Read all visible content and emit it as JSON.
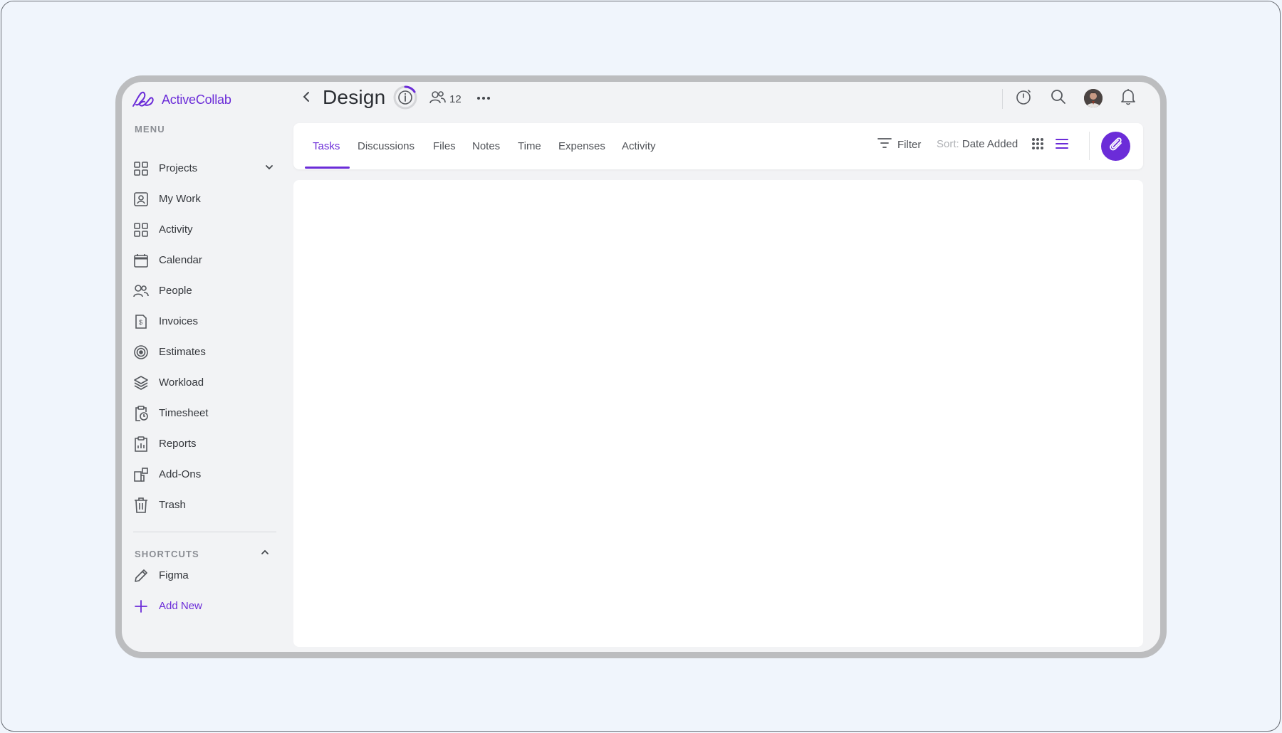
{
  "app": {
    "name": "ActiveCollab",
    "brand_color": "#6b2cd8"
  },
  "sidebar": {
    "menu_heading": "MENU",
    "items": [
      {
        "label": "Projects",
        "icon": "grid-icon"
      },
      {
        "label": "My Work",
        "icon": "user-card-icon"
      },
      {
        "label": "Activity",
        "icon": "grid-icon"
      },
      {
        "label": "Calendar",
        "icon": "calendar-icon"
      },
      {
        "label": "People",
        "icon": "people-icon"
      },
      {
        "label": "Invoices",
        "icon": "invoice-icon"
      },
      {
        "label": "Estimates",
        "icon": "target-icon"
      },
      {
        "label": "Workload",
        "icon": "layers-icon"
      },
      {
        "label": "Timesheet",
        "icon": "timesheet-icon"
      },
      {
        "label": "Reports",
        "icon": "clipboard-chart-icon"
      },
      {
        "label": "Add-Ons",
        "icon": "addons-icon"
      },
      {
        "label": "Trash",
        "icon": "trash-icon"
      }
    ],
    "shortcuts_heading": "SHORTCUTS",
    "shortcuts": [
      {
        "label": "Figma",
        "icon": "pencil-icon"
      },
      {
        "label": "Add New",
        "icon": "plus-icon"
      }
    ]
  },
  "header": {
    "title": "Design",
    "people_count": "12"
  },
  "tabs": [
    {
      "label": "Tasks",
      "active": true
    },
    {
      "label": "Discussions",
      "active": false
    },
    {
      "label": "Files",
      "active": false
    },
    {
      "label": "Notes",
      "active": false
    },
    {
      "label": "Time",
      "active": false
    },
    {
      "label": "Expenses",
      "active": false
    },
    {
      "label": "Activity",
      "active": false
    }
  ],
  "toolbar": {
    "filter_label": "Filter",
    "sort_prefix": "Sort:",
    "sort_value": "Date Added"
  }
}
